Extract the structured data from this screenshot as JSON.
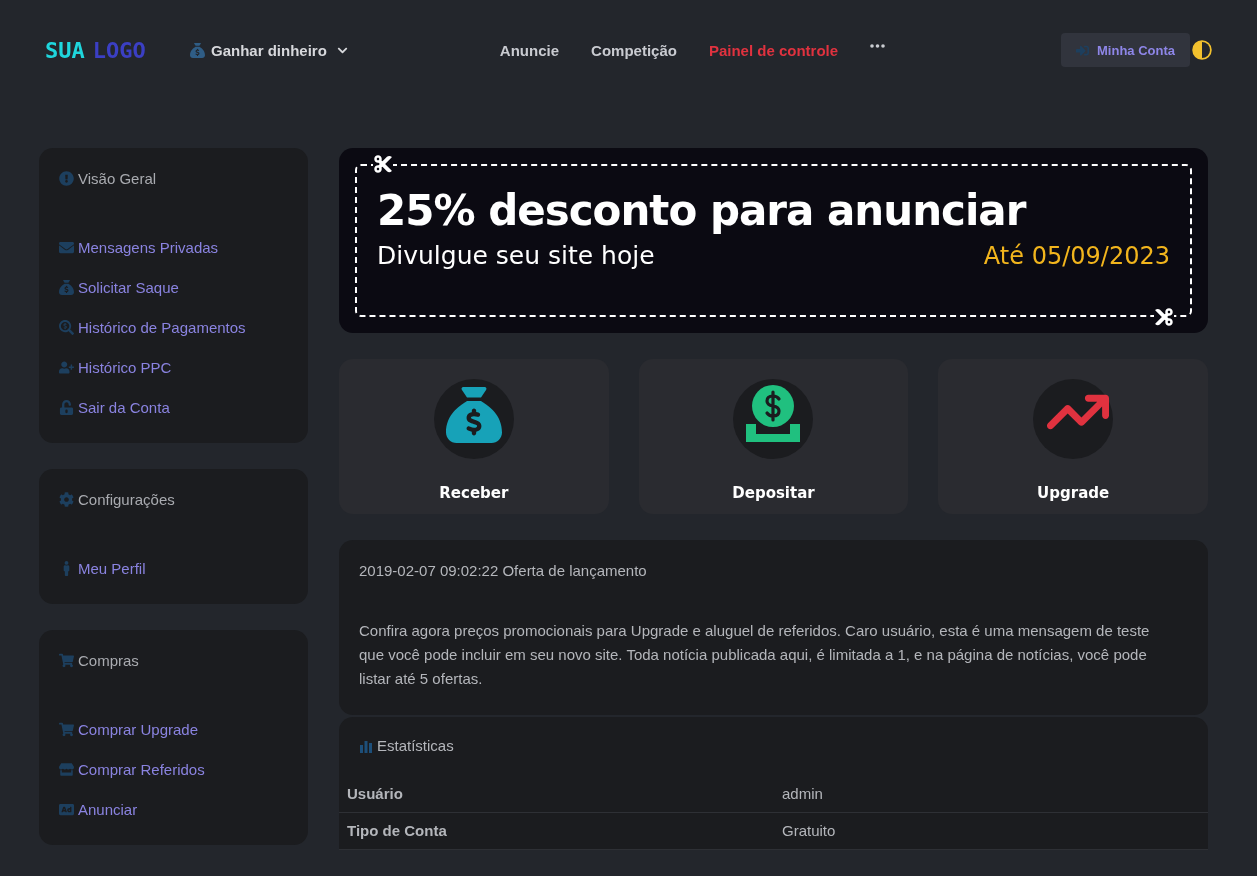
{
  "header": {
    "logo": {
      "first": "SUA",
      "second": "LOGO"
    },
    "earn_menu": {
      "label": "Ganhar dinheiro"
    },
    "nav": [
      {
        "label": "Anuncie",
        "selected": false
      },
      {
        "label": "Competição",
        "selected": false
      },
      {
        "label": "Painel de controle",
        "selected": true
      }
    ],
    "account_button": {
      "label": "Minha Conta"
    }
  },
  "sidebar": [
    {
      "title": "Visão Geral",
      "items": [
        "Mensagens Privadas",
        "Solicitar Saque",
        "Histórico de Pagamentos",
        "Histórico PPC",
        "Sair da Conta"
      ]
    },
    {
      "title": "Configurações",
      "items": [
        "Meu Perfil"
      ]
    },
    {
      "title": "Compras",
      "items": [
        "Comprar Upgrade",
        "Comprar Referidos",
        "Anunciar"
      ]
    }
  ],
  "banner": {
    "title": "25% desconto para anunciar",
    "subtitle": "Divulgue seu site hoje",
    "valid_until": "Até 05/09/2023"
  },
  "actions": [
    {
      "label": "Receber"
    },
    {
      "label": "Depositar"
    },
    {
      "label": "Upgrade"
    }
  ],
  "news": {
    "heading": "2019-02-07 09:02:22 Oferta de lançamento",
    "body": "Confira agora preços promocionais para Upgrade e aluguel de referidos. Caro usuário, esta é uma mensagem de teste que você pode incluir em seu novo site. Toda notícia publicada aqui, é limitada a 1, e na página de notícias, você pode listar até 5 ofertas."
  },
  "stats": {
    "title": "Estatísticas",
    "rows": [
      {
        "label": "Usuário",
        "value": "admin"
      },
      {
        "label": "Tipo de Conta",
        "value": "Gratuito"
      }
    ]
  }
}
